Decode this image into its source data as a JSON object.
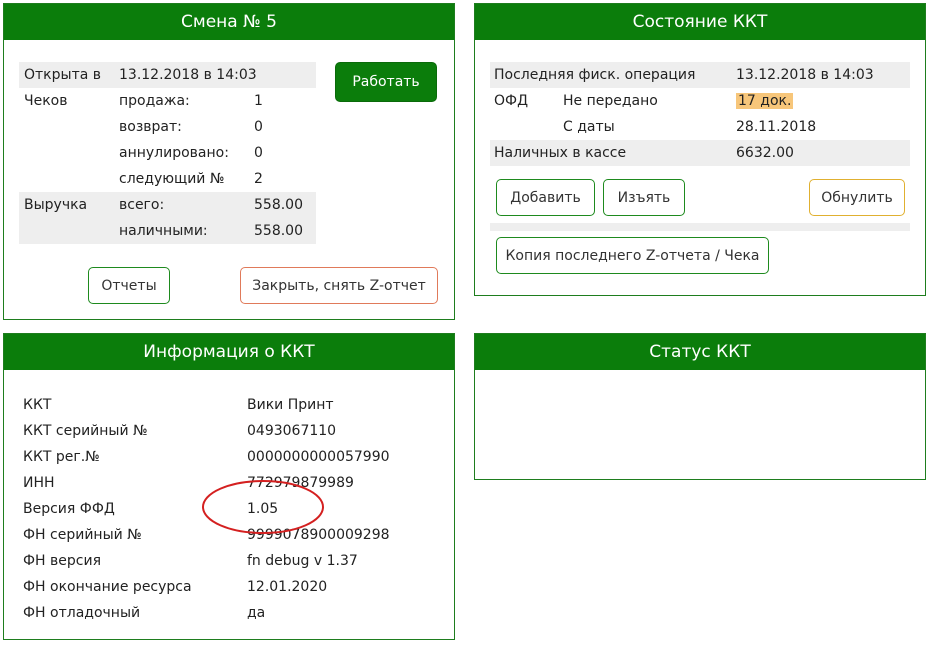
{
  "shift": {
    "title": "Смена № 5",
    "opened_label": "Открыта в",
    "opened_value": "13.12.2018 в 14:03",
    "checks_label": "Чеков",
    "sale_label": "продажа:",
    "sale_value": "1",
    "return_label": "возврат:",
    "return_value": "0",
    "canceled_label": "аннулировано:",
    "canceled_value": "0",
    "next_label": "следующий №",
    "next_value": "2",
    "revenue_label": "Выручка",
    "total_label": "всего:",
    "total_value": "558.00",
    "cash_label": "наличными:",
    "cash_value": "558.00",
    "work_button": "Работать",
    "reports_button": "Отчеты",
    "close_button": "Закрыть, снять Z-отчет"
  },
  "kkt_state": {
    "title": "Состояние ККТ",
    "last_op_label": "Последняя фиск. операция",
    "last_op_value": "13.12.2018 в 14:03",
    "ofd_label": "ОФД",
    "not_sent_label": "Не передано",
    "not_sent_value": "17 док.",
    "since_label": "С даты",
    "since_value": "28.11.2018",
    "cash_label": "Наличных в кассе",
    "cash_value": "6632.00",
    "add_button": "Добавить",
    "withdraw_button": "Изъять",
    "reset_button": "Обнулить",
    "copy_button": "Копия последнего Z-отчета / Чека",
    "highlight_color": "#f7c67a"
  },
  "kkt_info": {
    "title": "Информация о ККТ",
    "rows": [
      {
        "label": "ККТ",
        "value": "Вики Принт"
      },
      {
        "label": "ККТ серийный №",
        "value": "0493067110"
      },
      {
        "label": "ККТ рег.№",
        "value": "0000000000057990"
      },
      {
        "label": "ИНН",
        "value": "772979879989"
      },
      {
        "label": "Версия ФФД",
        "value": "1.05"
      },
      {
        "label": "ФН серийный №",
        "value": "9999078900009298"
      },
      {
        "label": "ФН версия",
        "value": "fn debug v 1.37"
      },
      {
        "label": "ФН окончание ресурса",
        "value": "12.01.2020"
      },
      {
        "label": "ФН отладочный",
        "value": "да"
      }
    ],
    "annotation_color": "#d42020"
  },
  "status": {
    "title": "Статус ККТ"
  },
  "colors": {
    "header_green": "#0b7d0b",
    "border_green": "#1e7d1e"
  }
}
